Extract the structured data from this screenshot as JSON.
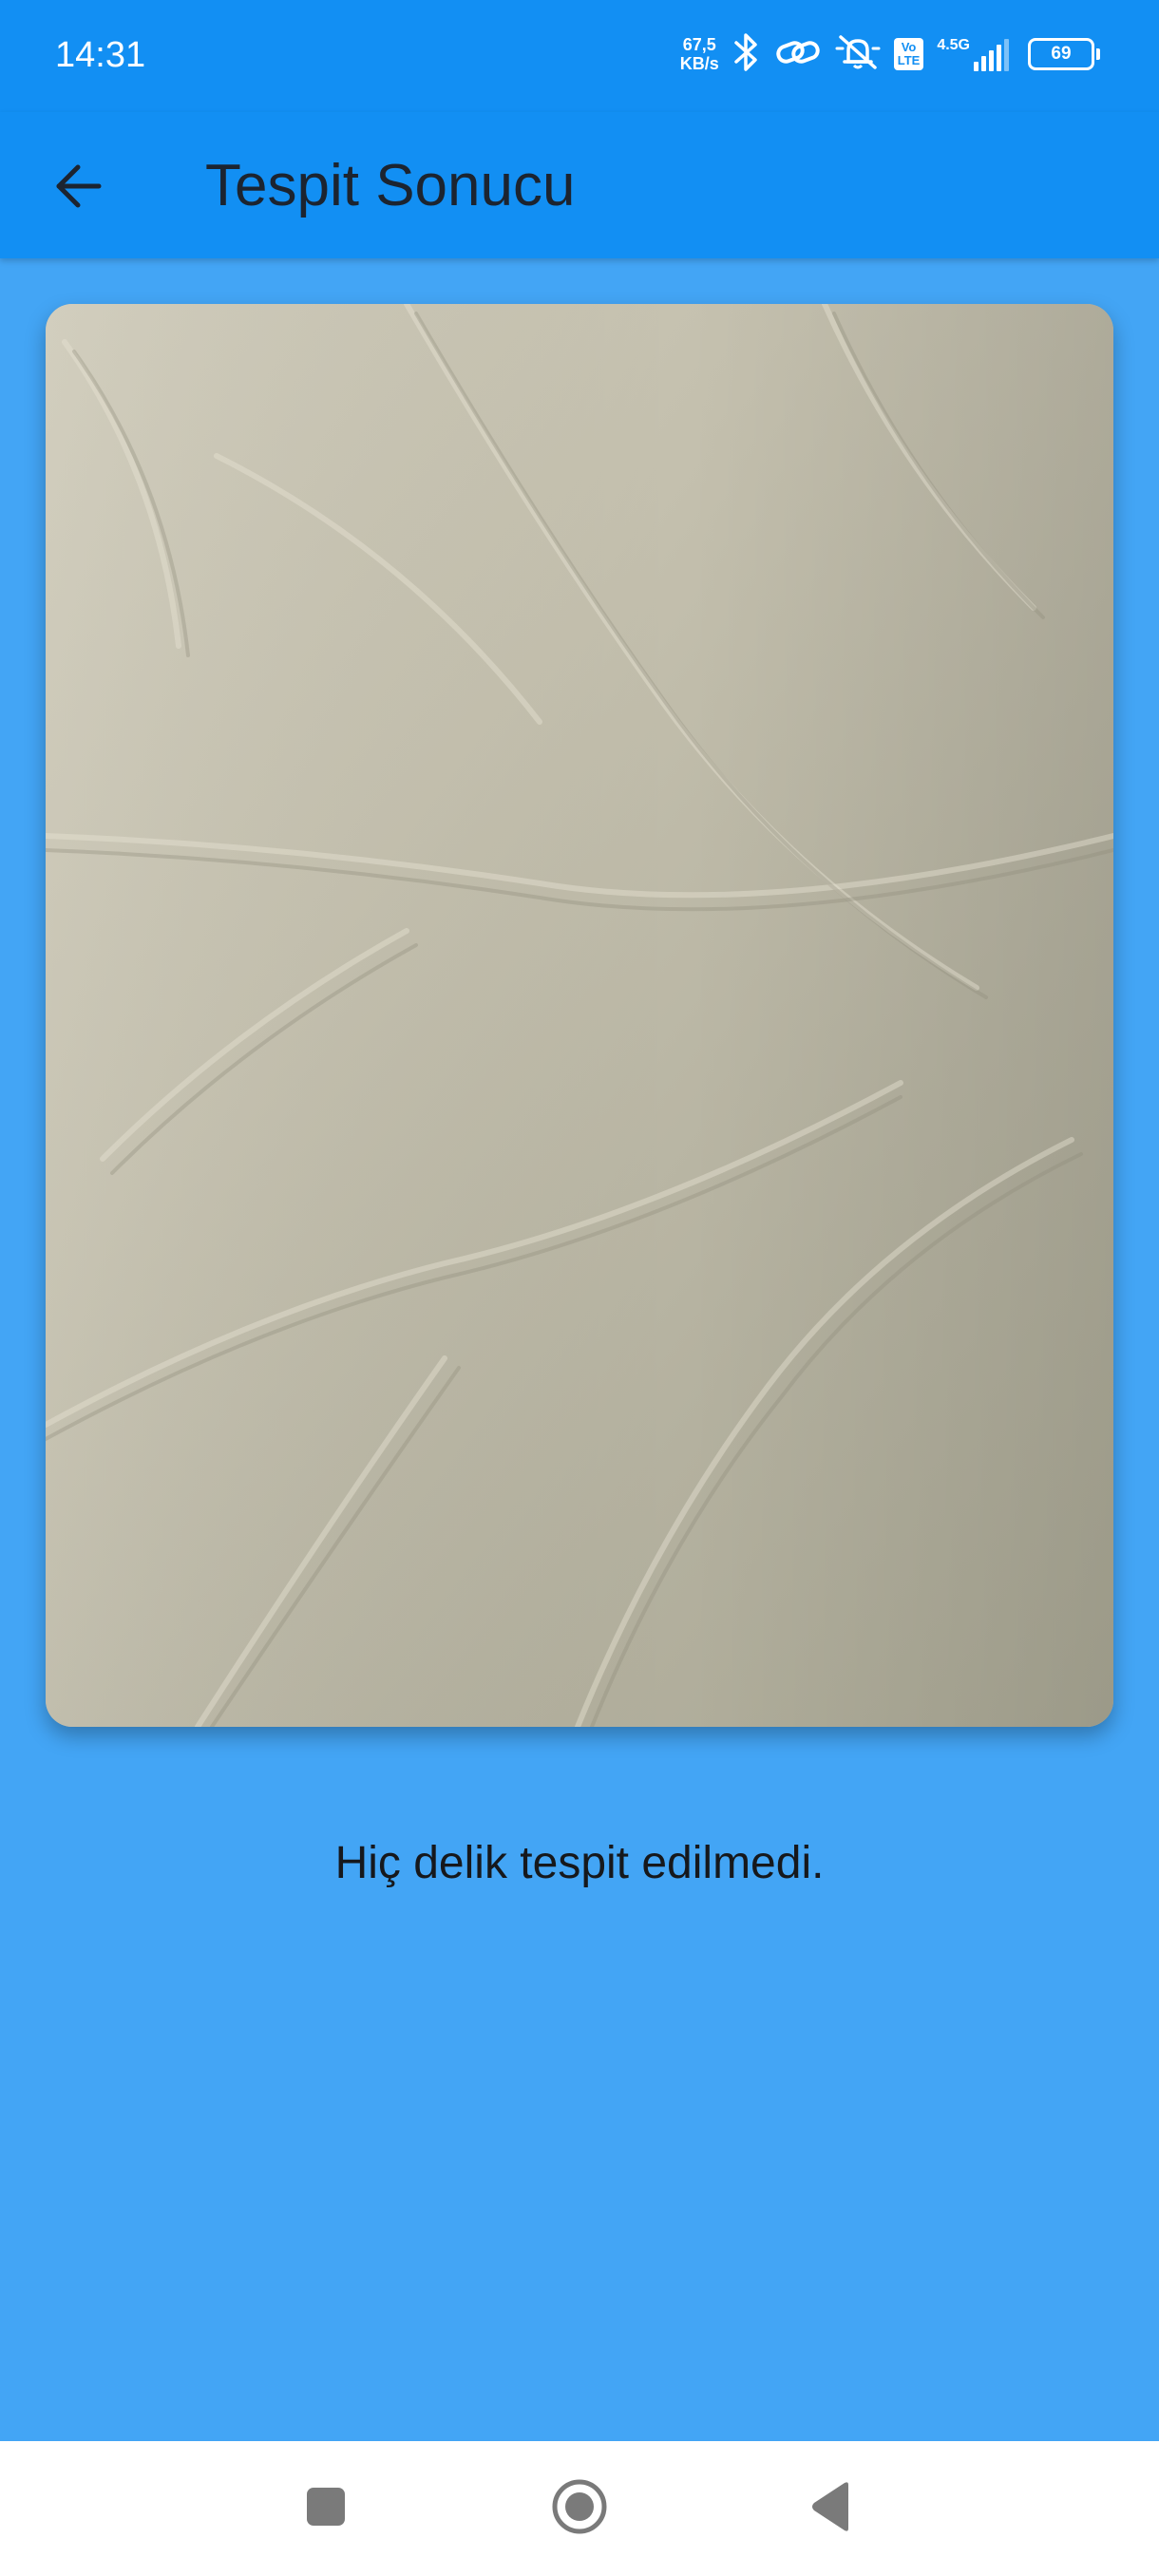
{
  "status_bar": {
    "time": "14:31",
    "speed_value": "67,5",
    "speed_unit": "KB/s",
    "volte_label": "Vo\nLTE",
    "network_type": "4.5G",
    "battery_level": "69",
    "icons": [
      "bluetooth-icon",
      "link-icon",
      "alarm-off-icon",
      "volte-icon",
      "signal-icon",
      "battery-icon"
    ]
  },
  "app_bar": {
    "title": "Tespit Sonucu",
    "back_icon": "arrow-left-icon",
    "color": "#128FF3"
  },
  "content": {
    "image_subject": "wrinkled cream fabric",
    "result_message": "Hiç delik tespit edilmedi.",
    "background_color": "#43A5F5"
  },
  "nav_bar": {
    "buttons": [
      "recent-apps-icon",
      "home-icon",
      "back-triangle-icon"
    ]
  }
}
